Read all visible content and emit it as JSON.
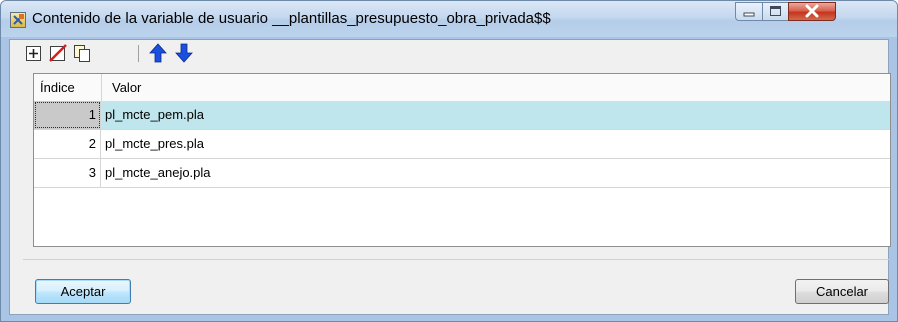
{
  "window": {
    "title": "Contenido de la variable de usuario __plantillas_presupuesto_obra_privada$$",
    "controls": {
      "minimize": "minimize",
      "maximize": "maximize",
      "close": "close"
    }
  },
  "toolbar": {
    "buttons": [
      {
        "name": "add",
        "icon": "add-row-icon"
      },
      {
        "name": "delete",
        "icon": "delete-row-icon"
      },
      {
        "name": "copy",
        "icon": "copy-row-icon"
      },
      {
        "name": "move-up",
        "icon": "arrow-up-icon"
      },
      {
        "name": "move-down",
        "icon": "arrow-down-icon"
      }
    ]
  },
  "grid": {
    "columns": [
      "Índice",
      "Valor"
    ],
    "rows": [
      {
        "index": "1",
        "value": "pl_mcte_pem.pla",
        "selected": true
      },
      {
        "index": "2",
        "value": "pl_mcte_pres.pla",
        "selected": false
      },
      {
        "index": "3",
        "value": "pl_mcte_anejo.pla",
        "selected": false
      }
    ],
    "selection_color": "#bfe6ec"
  },
  "footer": {
    "accept_label": "Aceptar",
    "cancel_label": "Cancelar"
  }
}
